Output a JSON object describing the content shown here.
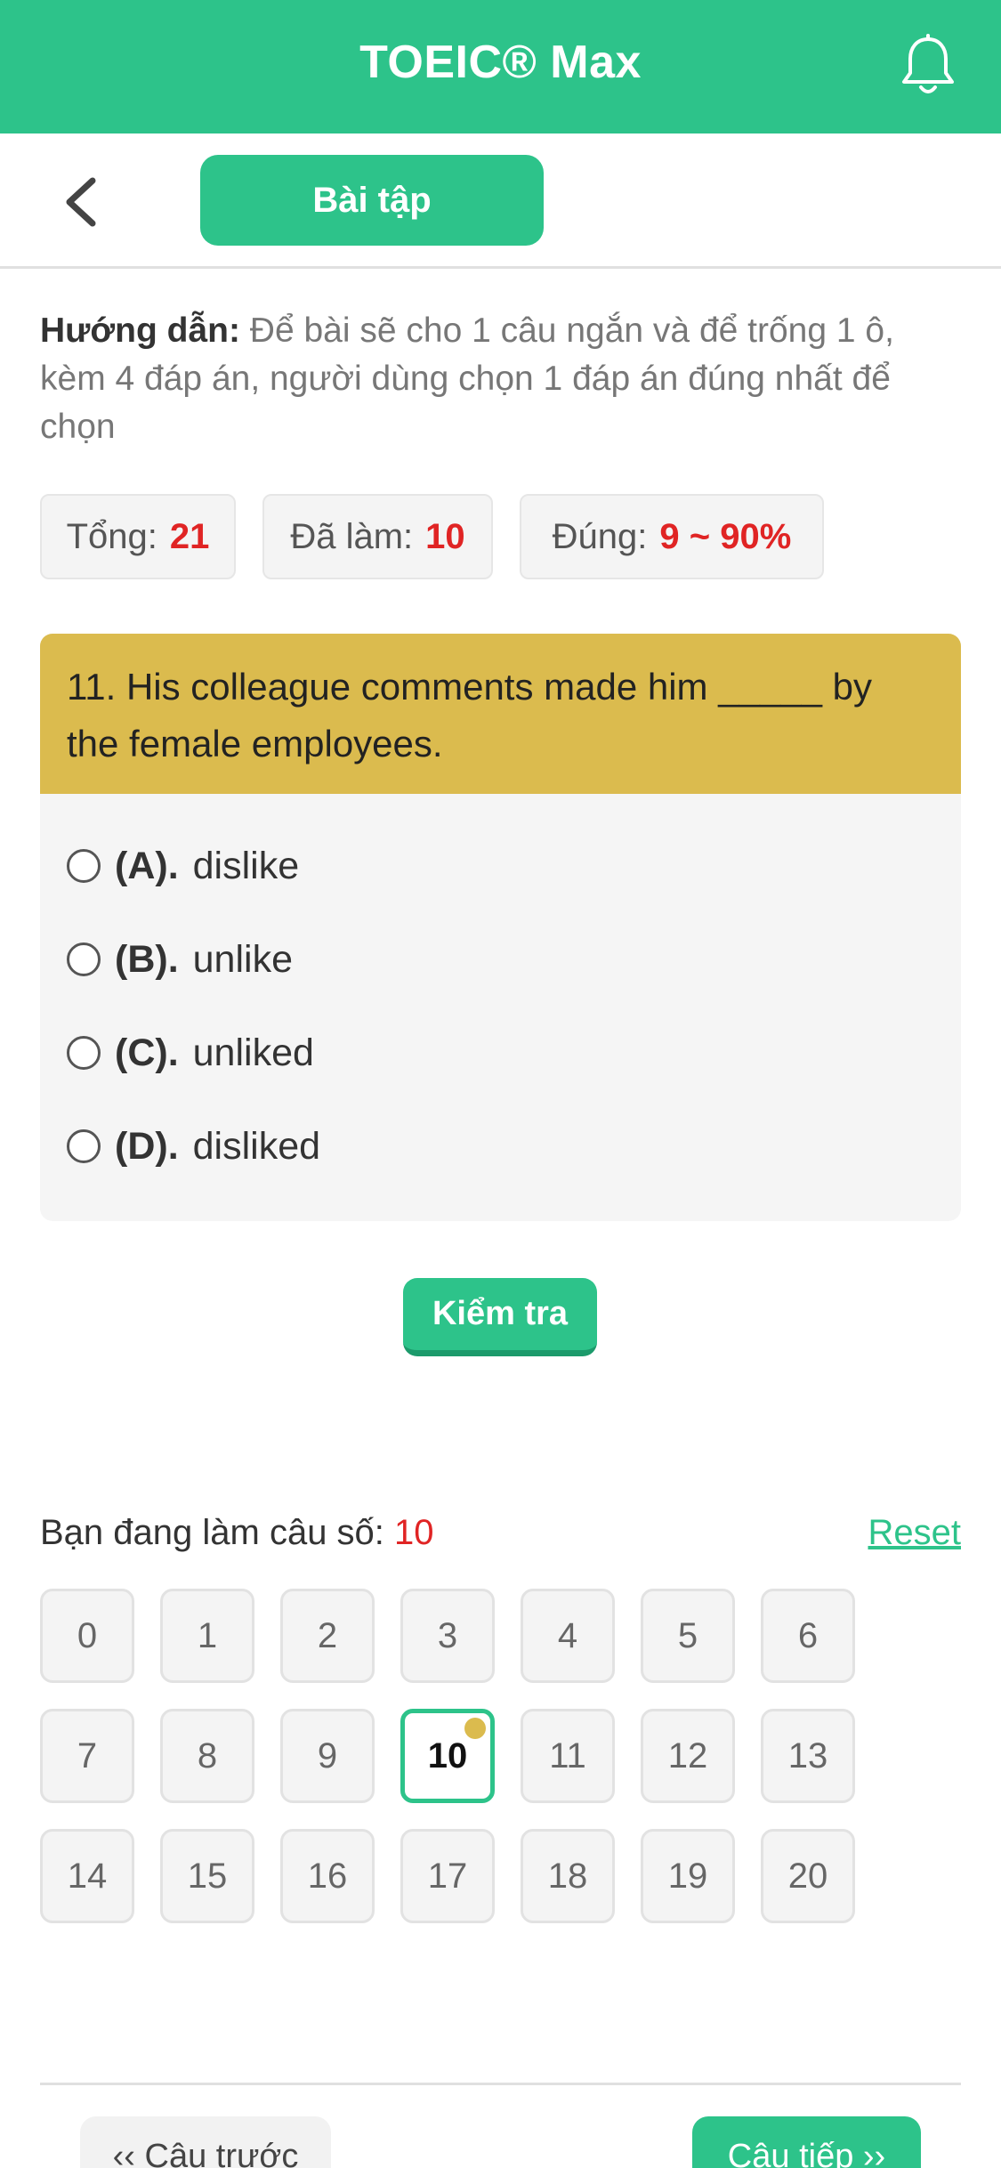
{
  "header": {
    "app_title": "TOEIC® Max",
    "bell_icon": "bell-icon"
  },
  "nav": {
    "back_icon": "chevron-left-icon",
    "tab_label": "Bài tập"
  },
  "instructions": {
    "label": "Hướng dẫn:",
    "text": "Để bài sẽ cho 1 câu ngắn và để trống 1 ô, kèm 4 đáp án, người dùng chọn 1 đáp án đúng nhất để chọn"
  },
  "stats": {
    "total_label": "Tổng:",
    "total_value": "21",
    "done_label": "Đã làm:",
    "done_value": "10",
    "correct_label": "Đúng:",
    "correct_value": "9 ~ 90%"
  },
  "question": {
    "text": "11. His colleague comments made him _____ by the female employees.",
    "options": [
      {
        "key": "(A).",
        "text": "dislike"
      },
      {
        "key": "(B).",
        "text": "unlike"
      },
      {
        "key": "(C).",
        "text": "unliked"
      },
      {
        "key": "(D).",
        "text": "disliked"
      }
    ]
  },
  "check_button": "Kiểm tra",
  "progress": {
    "label": "Bạn đang làm câu số:",
    "current": "10",
    "reset_label": "Reset"
  },
  "question_numbers": [
    "0",
    "1",
    "2",
    "3",
    "4",
    "5",
    "6",
    "7",
    "8",
    "9",
    "10",
    "11",
    "12",
    "13",
    "14",
    "15",
    "16",
    "17",
    "18",
    "19",
    "20"
  ],
  "footer": {
    "prev_label": "‹‹ Câu trước",
    "next_label": "Câu tiếp ››"
  },
  "colors": {
    "brand_green": "#2dc38a",
    "question_header": "#dbbb4e",
    "highlight_red": "#e02424"
  }
}
